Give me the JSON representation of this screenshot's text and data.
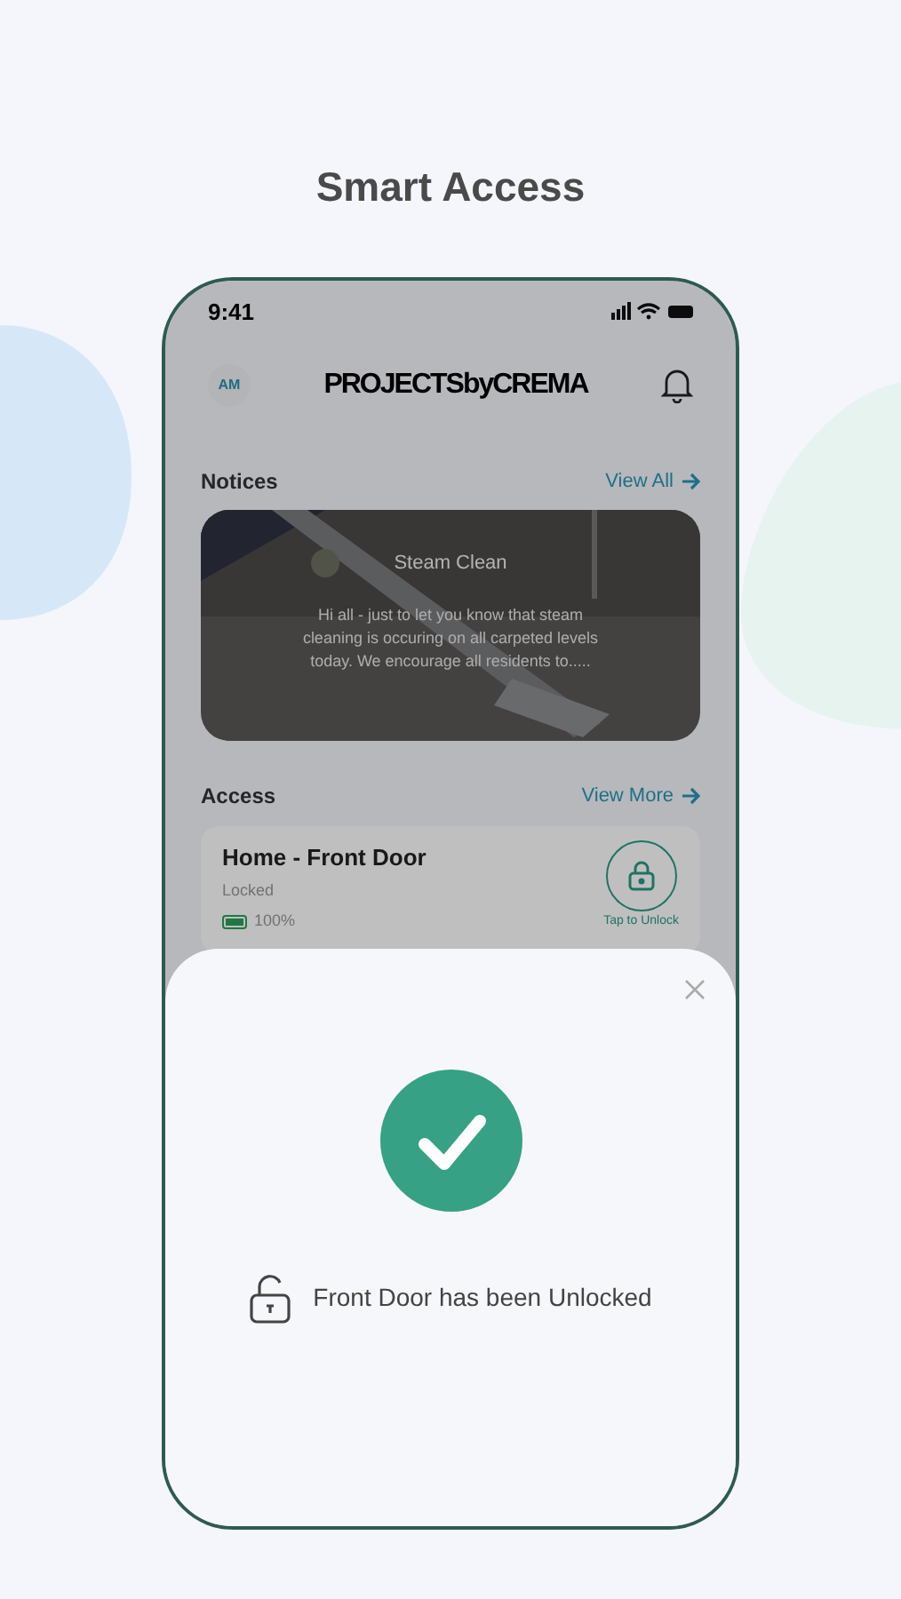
{
  "heading": "Smart Access",
  "status_bar": {
    "time": "9:41"
  },
  "header": {
    "avatar": "AM",
    "logo": "PROJECTSbyCREMA"
  },
  "notices": {
    "title": "Notices",
    "link": "View All",
    "card": {
      "title": "Steam Clean",
      "body": "Hi all - just to let you know that steam cleaning is occuring on all carpeted levels today. We encourage all residents to....."
    }
  },
  "access": {
    "title": "Access",
    "link": "View More",
    "door": {
      "name": "Home - Front Door",
      "status": "Locked",
      "battery": "100%",
      "action": "Tap to Unlock"
    }
  },
  "sheet": {
    "message": "Front Door has been Unlocked"
  }
}
